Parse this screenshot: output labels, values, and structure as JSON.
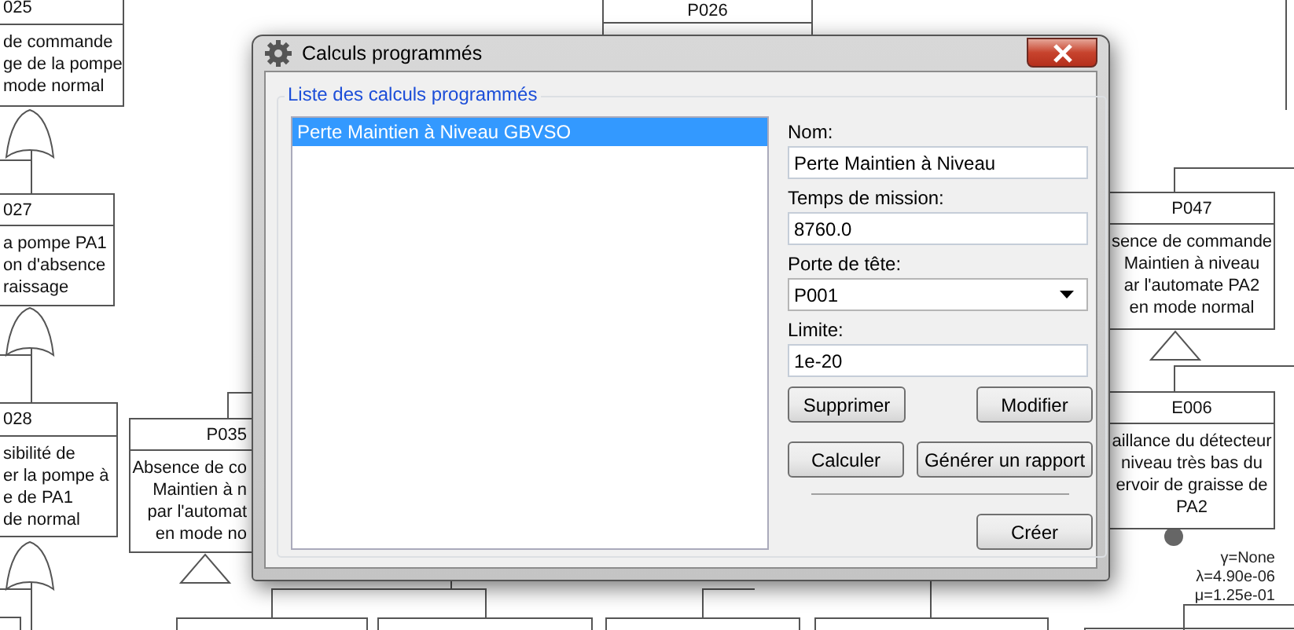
{
  "diagram": {
    "events": [
      {
        "code": "025",
        "lines": [
          "de commande",
          "ge de la pompe",
          "mode normal"
        ]
      },
      {
        "code": "027",
        "lines": [
          "a pompe PA1",
          "on d'absence",
          "raissage"
        ]
      },
      {
        "code": "028",
        "lines": [
          "sibilité de",
          "er la pompe à",
          "e de PA1",
          "de normal"
        ]
      },
      {
        "code": "P035",
        "lines": [
          "Absence de co",
          "Maintien à n",
          "par l'automat",
          "en mode no"
        ]
      },
      {
        "code": "P026"
      },
      {
        "code": "P047",
        "lines": [
          "sence de commande",
          "Maintien à niveau",
          "ar l'automate PA2",
          "en mode normal"
        ]
      },
      {
        "code": "E006",
        "lines": [
          "aillance du détecteur",
          "niveau très bas du",
          "ervoir de graisse de",
          "PA2"
        ]
      },
      {
        "kind": "stub"
      },
      {
        "kind": "stub"
      },
      {
        "kind": "stub"
      },
      {
        "kind": "stub"
      }
    ],
    "parameters": [
      "γ=None",
      "λ=4.90e-06",
      "μ=1.25e-01"
    ]
  },
  "dialog": {
    "title": "Calculs programmés",
    "group_label": "Liste des calculs programmés",
    "list": [
      {
        "label": "Perte Maintien à Niveau GBVSO",
        "selected": true
      }
    ],
    "fields": [
      {
        "kind": "text",
        "label": "Nom:",
        "value": "Perte Maintien à Niveau"
      },
      {
        "kind": "text",
        "label": "Temps de mission:",
        "value": "8760.0"
      },
      {
        "kind": "dropdown",
        "label": "Porte de tête:",
        "value": "P001"
      },
      {
        "kind": "text",
        "label": "Limite:",
        "value": "1e-20"
      }
    ],
    "buttons": [
      "Supprimer",
      "Modifier",
      "Calculer",
      "Générer un rapport",
      "Créer"
    ]
  }
}
